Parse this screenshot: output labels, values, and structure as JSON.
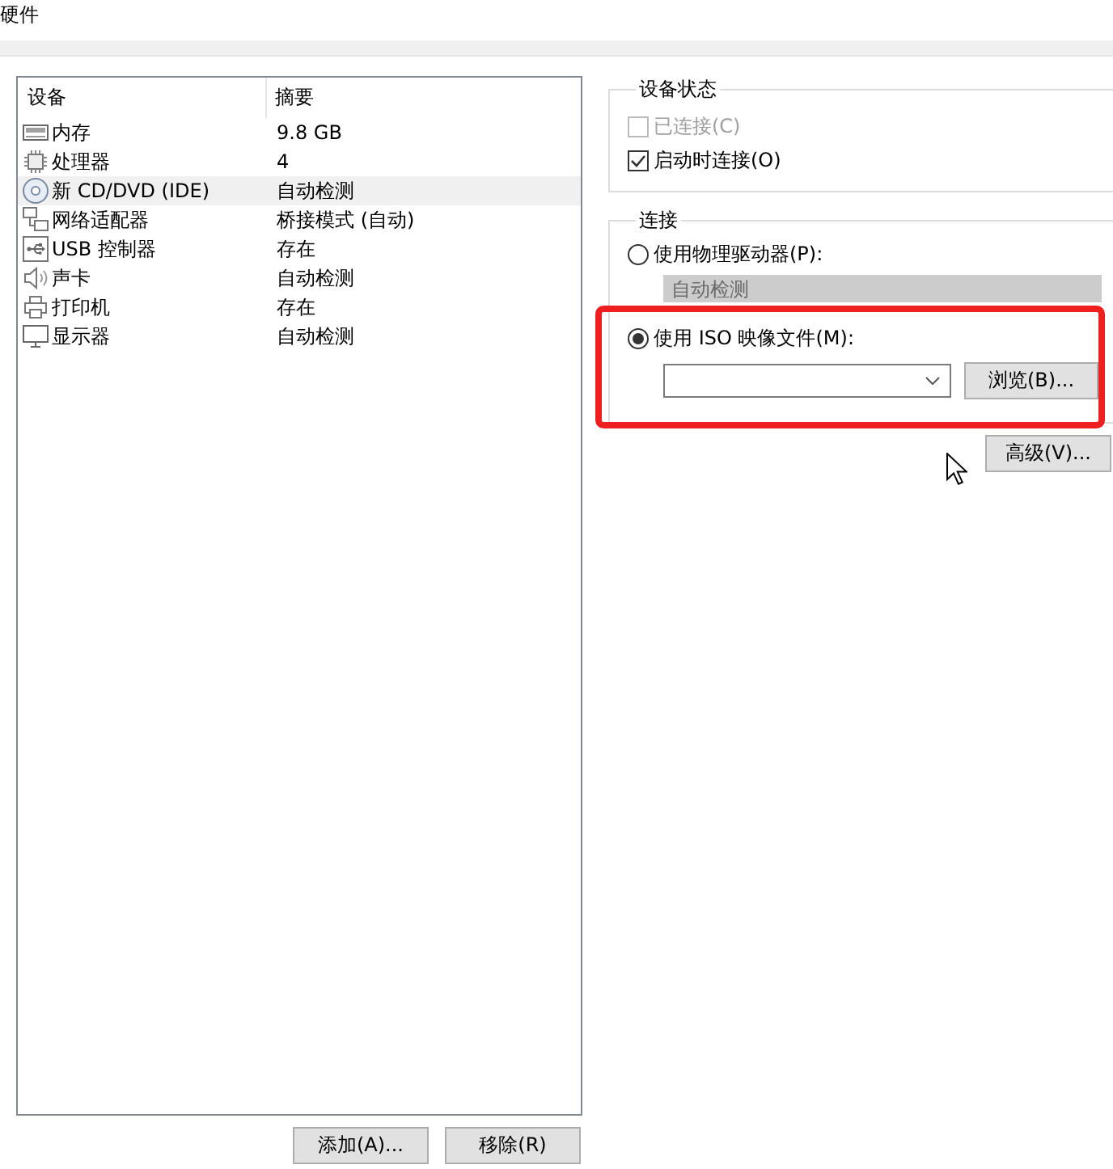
{
  "title": "硬件",
  "device_list": {
    "columns": [
      "设备",
      "摘要"
    ],
    "rows": [
      {
        "kind": "memory",
        "device": "内存",
        "summary": "9.8 GB",
        "selected": false
      },
      {
        "kind": "processor",
        "device": "处理器",
        "summary": "4",
        "selected": false
      },
      {
        "kind": "cd_dvd",
        "device": "新 CD/DVD (IDE)",
        "summary": "自动检测",
        "selected": true
      },
      {
        "kind": "network",
        "device": "网络适配器",
        "summary": "桥接模式 (自动)",
        "selected": false
      },
      {
        "kind": "usb",
        "device": "USB 控制器",
        "summary": "存在",
        "selected": false
      },
      {
        "kind": "sound",
        "device": "声卡",
        "summary": "自动检测",
        "selected": false
      },
      {
        "kind": "printer",
        "device": "打印机",
        "summary": "存在",
        "selected": false
      },
      {
        "kind": "display",
        "device": "显示器",
        "summary": "自动检测",
        "selected": false
      }
    ],
    "buttons": [
      "添加(A)...",
      "移除(R)"
    ]
  },
  "device_status": {
    "title": "设备状态",
    "options": [
      {
        "label": "已连接(C)",
        "checked": false,
        "disabled": true
      },
      {
        "label": "启动时连接(O)",
        "checked": true,
        "disabled": false
      }
    ]
  },
  "connection": {
    "title": "连接",
    "options": [
      {
        "kind": "physical_drive",
        "label": "使用物理驱动器(P):",
        "selected": false,
        "highlighted": false,
        "drive": {
          "value": "自动检测",
          "disabled": true
        }
      },
      {
        "kind": "iso_image",
        "label": "使用 ISO 映像文件(M):",
        "selected": true,
        "highlighted": true,
        "browse_button": "浏览(B)..."
      }
    ],
    "advanced_button": "高级(V)..."
  }
}
